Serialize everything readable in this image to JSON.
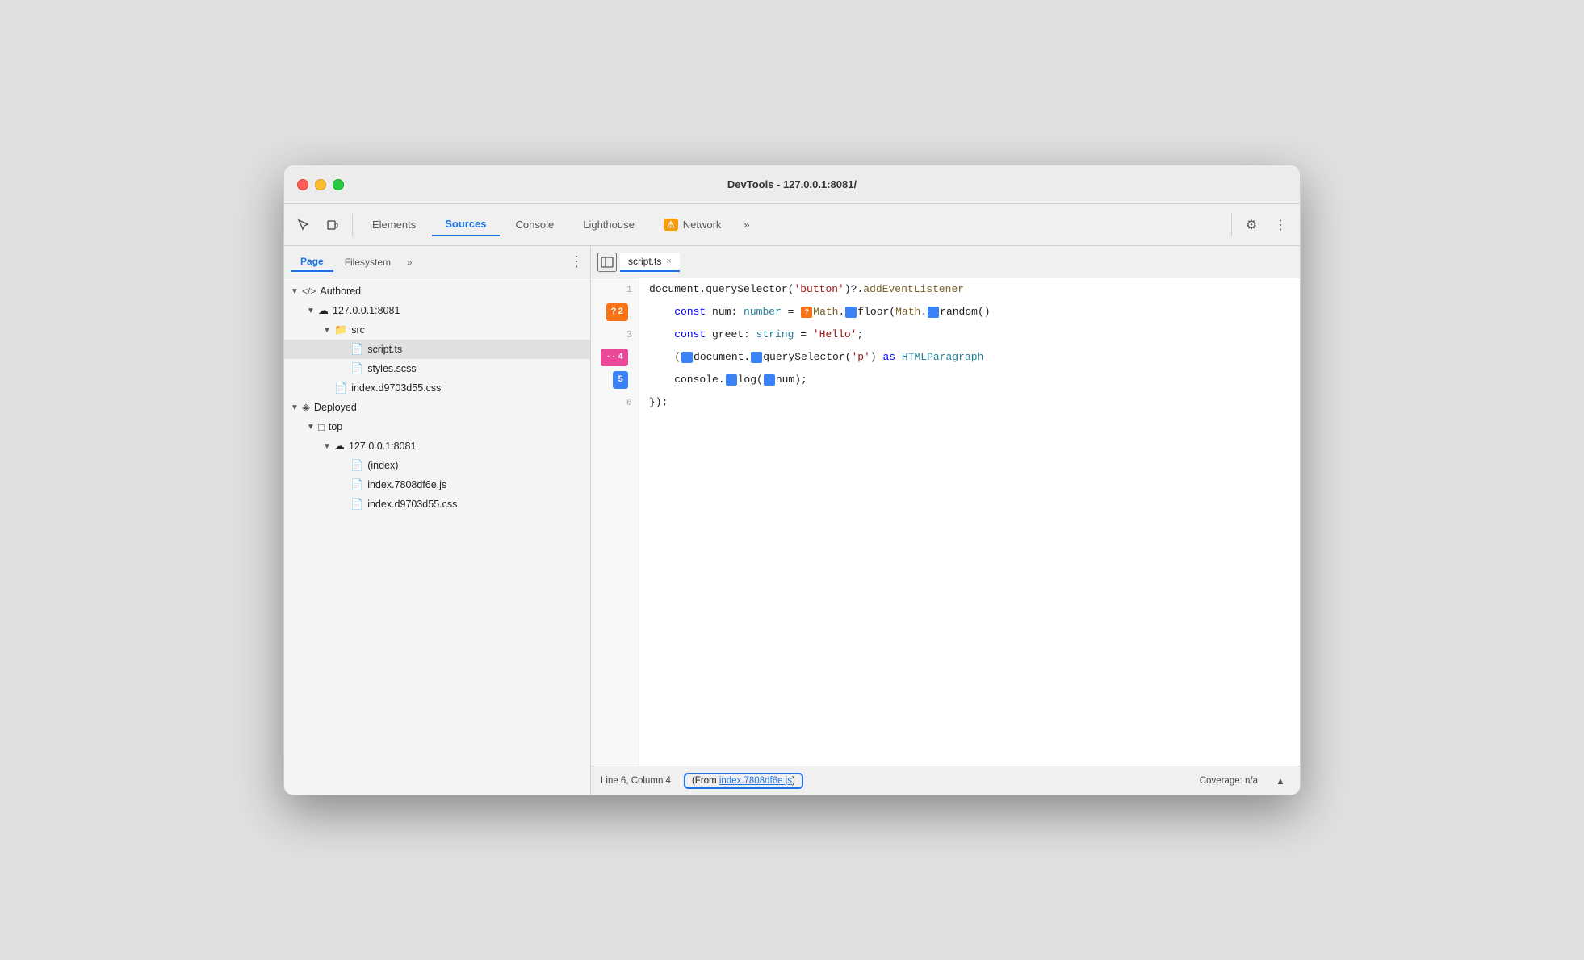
{
  "window": {
    "title": "DevTools - 127.0.0.1:8081/"
  },
  "toolbar": {
    "tabs": [
      {
        "id": "elements",
        "label": "Elements",
        "active": false
      },
      {
        "id": "sources",
        "label": "Sources",
        "active": true
      },
      {
        "id": "console",
        "label": "Console",
        "active": false
      },
      {
        "id": "lighthouse",
        "label": "Lighthouse",
        "active": false
      },
      {
        "id": "network",
        "label": "Network",
        "active": false
      }
    ],
    "more_label": "»",
    "settings_icon": "⚙",
    "more_menu_icon": "⋮",
    "network_warning": "⚠"
  },
  "left_panel": {
    "sub_tabs": [
      {
        "id": "page",
        "label": "Page",
        "active": true
      },
      {
        "id": "filesystem",
        "label": "Filesystem",
        "active": false
      }
    ],
    "more_label": "»",
    "menu_icon": "⋮",
    "tree": [
      {
        "indent": 0,
        "arrow": "▼",
        "icon": "</>",
        "label": "Authored",
        "type": "section"
      },
      {
        "indent": 1,
        "arrow": "▼",
        "icon": "☁",
        "label": "127.0.0.1:8081",
        "type": "host"
      },
      {
        "indent": 2,
        "arrow": "▼",
        "icon": "📁",
        "label": "src",
        "type": "folder",
        "color": "orange"
      },
      {
        "indent": 3,
        "arrow": "",
        "icon": "📄",
        "label": "script.ts",
        "type": "file",
        "color": "orange",
        "selected": true
      },
      {
        "indent": 3,
        "arrow": "",
        "icon": "📄",
        "label": "styles.scss",
        "type": "file",
        "color": "gray"
      },
      {
        "indent": 2,
        "arrow": "",
        "icon": "📄",
        "label": "index.d9703d55.css",
        "type": "file",
        "color": "purple"
      },
      {
        "indent": 0,
        "arrow": "▼",
        "icon": "◈",
        "label": "Deployed",
        "type": "section"
      },
      {
        "indent": 1,
        "arrow": "▼",
        "icon": "□",
        "label": "top",
        "type": "folder"
      },
      {
        "indent": 2,
        "arrow": "▼",
        "icon": "☁",
        "label": "127.0.0.1:8081",
        "type": "host"
      },
      {
        "indent": 3,
        "arrow": "",
        "icon": "📄",
        "label": "(index)",
        "type": "file",
        "color": "gray"
      },
      {
        "indent": 3,
        "arrow": "",
        "icon": "📄",
        "label": "index.7808df6e.js",
        "type": "file",
        "color": "orange"
      },
      {
        "indent": 3,
        "arrow": "",
        "icon": "📄",
        "label": "index.d9703d55.css",
        "type": "file",
        "color": "purple"
      }
    ]
  },
  "editor": {
    "back_icon": "◁|",
    "tab_label": "script.ts",
    "tab_close": "×",
    "lines": [
      {
        "num": 1,
        "badge": null,
        "code": "document.querySelector('button')?.addEventListener"
      },
      {
        "num": 2,
        "badge": "?2",
        "badge_type": "orange",
        "code": "    const num: number = Math.floor(Math.random()"
      },
      {
        "num": 3,
        "badge": null,
        "code": "    const greet: string = 'Hello';"
      },
      {
        "num": 4,
        "badge": "··4",
        "badge_type": "pink",
        "code": "    (document.querySelector('p') as HTMLParagraphe"
      },
      {
        "num": 5,
        "badge": "5",
        "badge_type": "blue",
        "code": "    console.log(num);"
      },
      {
        "num": 6,
        "badge": null,
        "code": "});"
      }
    ]
  },
  "status_bar": {
    "position": "Line 6, Column 4",
    "from_label": "From",
    "from_link": "index.7808df6e.js",
    "from_text": "(From index.7808df6e.js)",
    "coverage": "Coverage: n/a",
    "up_icon": "▲"
  }
}
